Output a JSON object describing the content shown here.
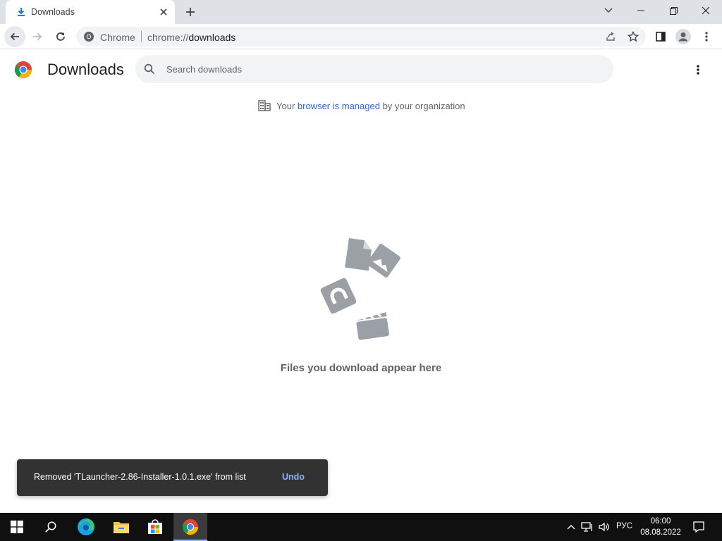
{
  "browser": {
    "tab_title": "Downloads",
    "omnibox_site": "Chrome",
    "omnibox_scheme": "chrome://",
    "omnibox_path": "downloads"
  },
  "page": {
    "title": "Downloads",
    "search_placeholder": "Search downloads",
    "managed_prefix": "Your ",
    "managed_link": "browser is managed",
    "managed_suffix": " by your organization",
    "empty_text": "Files you download appear here"
  },
  "toast": {
    "message": "Removed 'TLauncher-2.86-Installer-1.0.1.exe' from list",
    "action": "Undo"
  },
  "taskbar": {
    "language": "РУС",
    "time": "06:00",
    "date": "08.08.2022"
  },
  "colors": {
    "accent": "#1a73e8",
    "toast_bg": "#323232",
    "toast_action": "#8ab4f8",
    "taskbar_bg": "#101010"
  }
}
